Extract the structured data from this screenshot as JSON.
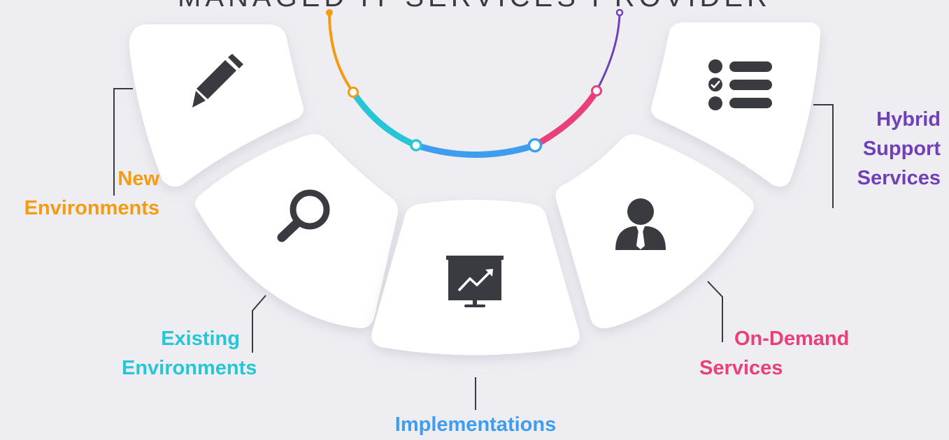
{
  "title": "MANAGED IT SERVICES PROVIDER",
  "colors": {
    "background": "#eeeef2",
    "card": "#ffffff",
    "icon": "#3a3b40",
    "connector": "#3a3b40",
    "orange": "#f39c12",
    "cyan": "#26c6d6",
    "blue": "#3f9df0",
    "pink": "#ea3f78",
    "purple": "#7040b8"
  },
  "segments": [
    {
      "id": "new-environments",
      "lines": [
        "New",
        "Environments"
      ],
      "color": "#f39c12",
      "icon": "pencil-icon"
    },
    {
      "id": "existing-environments",
      "lines": [
        "Existing",
        "Environments"
      ],
      "color": "#26c6d6",
      "icon": "magnifier-icon"
    },
    {
      "id": "implementations",
      "lines": [
        "Implementations"
      ],
      "color": "#3f9df0",
      "icon": "presentation-chart-icon"
    },
    {
      "id": "on-demand-services",
      "lines": [
        "On-Demand",
        "Services"
      ],
      "color": "#ea3f78",
      "icon": "businessman-icon"
    },
    {
      "id": "hybrid-support-services",
      "lines": [
        "Hybrid",
        "Support",
        "Services"
      ],
      "color": "#7040b8",
      "icon": "checklist-icon"
    }
  ]
}
